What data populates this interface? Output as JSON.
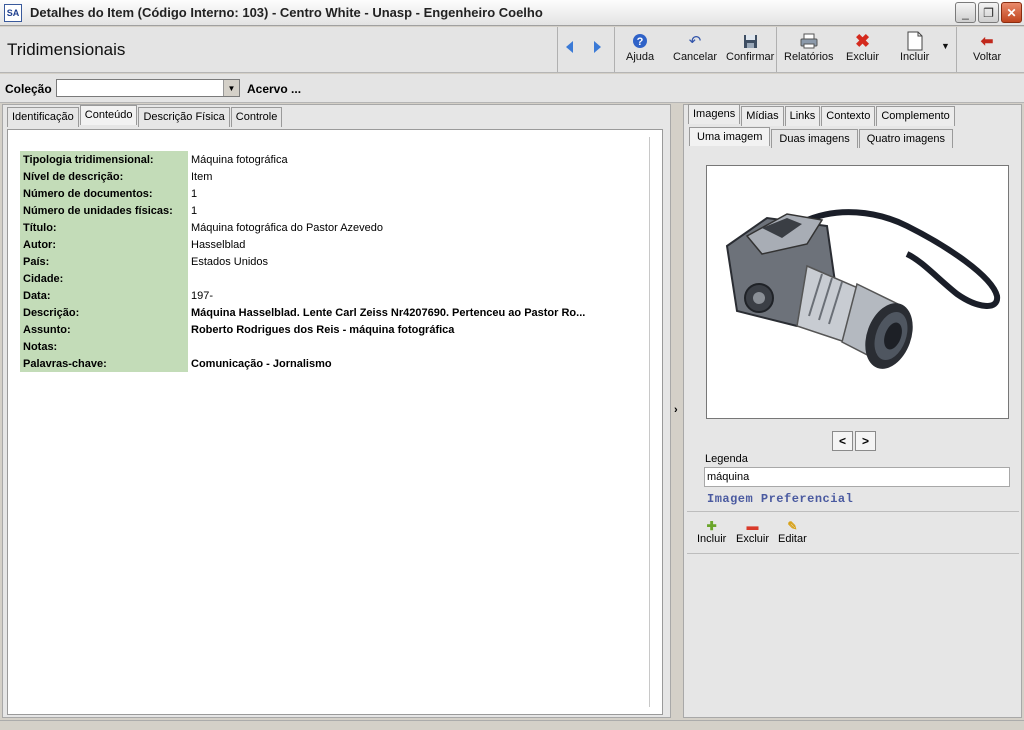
{
  "window": {
    "app_icon": "SA",
    "title": "Detalhes do Item (Código Interno: 103) - Centro White - Unasp - Engenheiro Coelho",
    "controls": {
      "minimize_icon": "minimize-icon",
      "restore_icon": "restore-icon",
      "close_icon": "close-icon"
    }
  },
  "toolbar": {
    "page_title": "Tridimensionais",
    "ajuda": "Ajuda",
    "cancelar": "Cancelar",
    "confirmar": "Confirmar",
    "relatorios": "Relatórios",
    "excluir": "Excluir",
    "incluir": "Incluir",
    "voltar": "Voltar"
  },
  "collection": {
    "label": "Coleção",
    "value": "",
    "acervo": "Acervo ..."
  },
  "left_tabs": [
    {
      "label": "Identificação"
    },
    {
      "label": "Conteúdo",
      "active": true
    },
    {
      "label": "Descrição Física"
    },
    {
      "label": "Controle"
    }
  ],
  "fields": [
    {
      "label": "Tipologia tridimensional:",
      "value": "Máquina fotográfica"
    },
    {
      "label": "Nível de descrição:",
      "value": "Item"
    },
    {
      "label": "Número de documentos:",
      "value": "1"
    },
    {
      "label": "Número de unidades físicas:",
      "value": "1"
    },
    {
      "label": "Título:",
      "value": "Máquina fotográfica do Pastor Azevedo"
    },
    {
      "label": "Autor:",
      "value": "Hasselblad"
    },
    {
      "label": "País:",
      "value": "Estados Unidos"
    },
    {
      "label": "Cidade:",
      "value": ""
    },
    {
      "label": "Data:",
      "value": "197-"
    },
    {
      "label": "Descrição:",
      "value": "Máquina Hasselblad. Lente Carl Zeiss Nr4207690.   Pertenceu ao Pastor Ro..."
    },
    {
      "label": "Assunto:",
      "value": "Roberto Rodrigues dos Reis - máquina fotográfica"
    },
    {
      "label": "Notas:",
      "value": ""
    },
    {
      "label": "Palavras-chave:",
      "value": "Comunicação -  Jornalismo"
    }
  ],
  "right_tabs": [
    {
      "label": "Imagens",
      "active": true
    },
    {
      "label": "Mídias"
    },
    {
      "label": "Links"
    },
    {
      "label": "Contexto"
    },
    {
      "label": "Complemento"
    }
  ],
  "image_tabs": [
    {
      "label": "Uma imagem",
      "active": true
    },
    {
      "label": "Duas imagens"
    },
    {
      "label": "Quatro imagens"
    }
  ],
  "image_panel": {
    "prev": "<",
    "next": ">",
    "legenda_label": "Legenda",
    "legenda_value": "máquina",
    "preferencial": "Imagem Preferencial",
    "incluir": "Incluir",
    "excluir": "Excluir",
    "editar": "Editar"
  },
  "splitter": {
    "arrow": "›"
  },
  "colors": {
    "label_bg": "#c3dcb8",
    "accent_blue": "#3b7ad6",
    "pref_text": "#4a5aa0"
  }
}
